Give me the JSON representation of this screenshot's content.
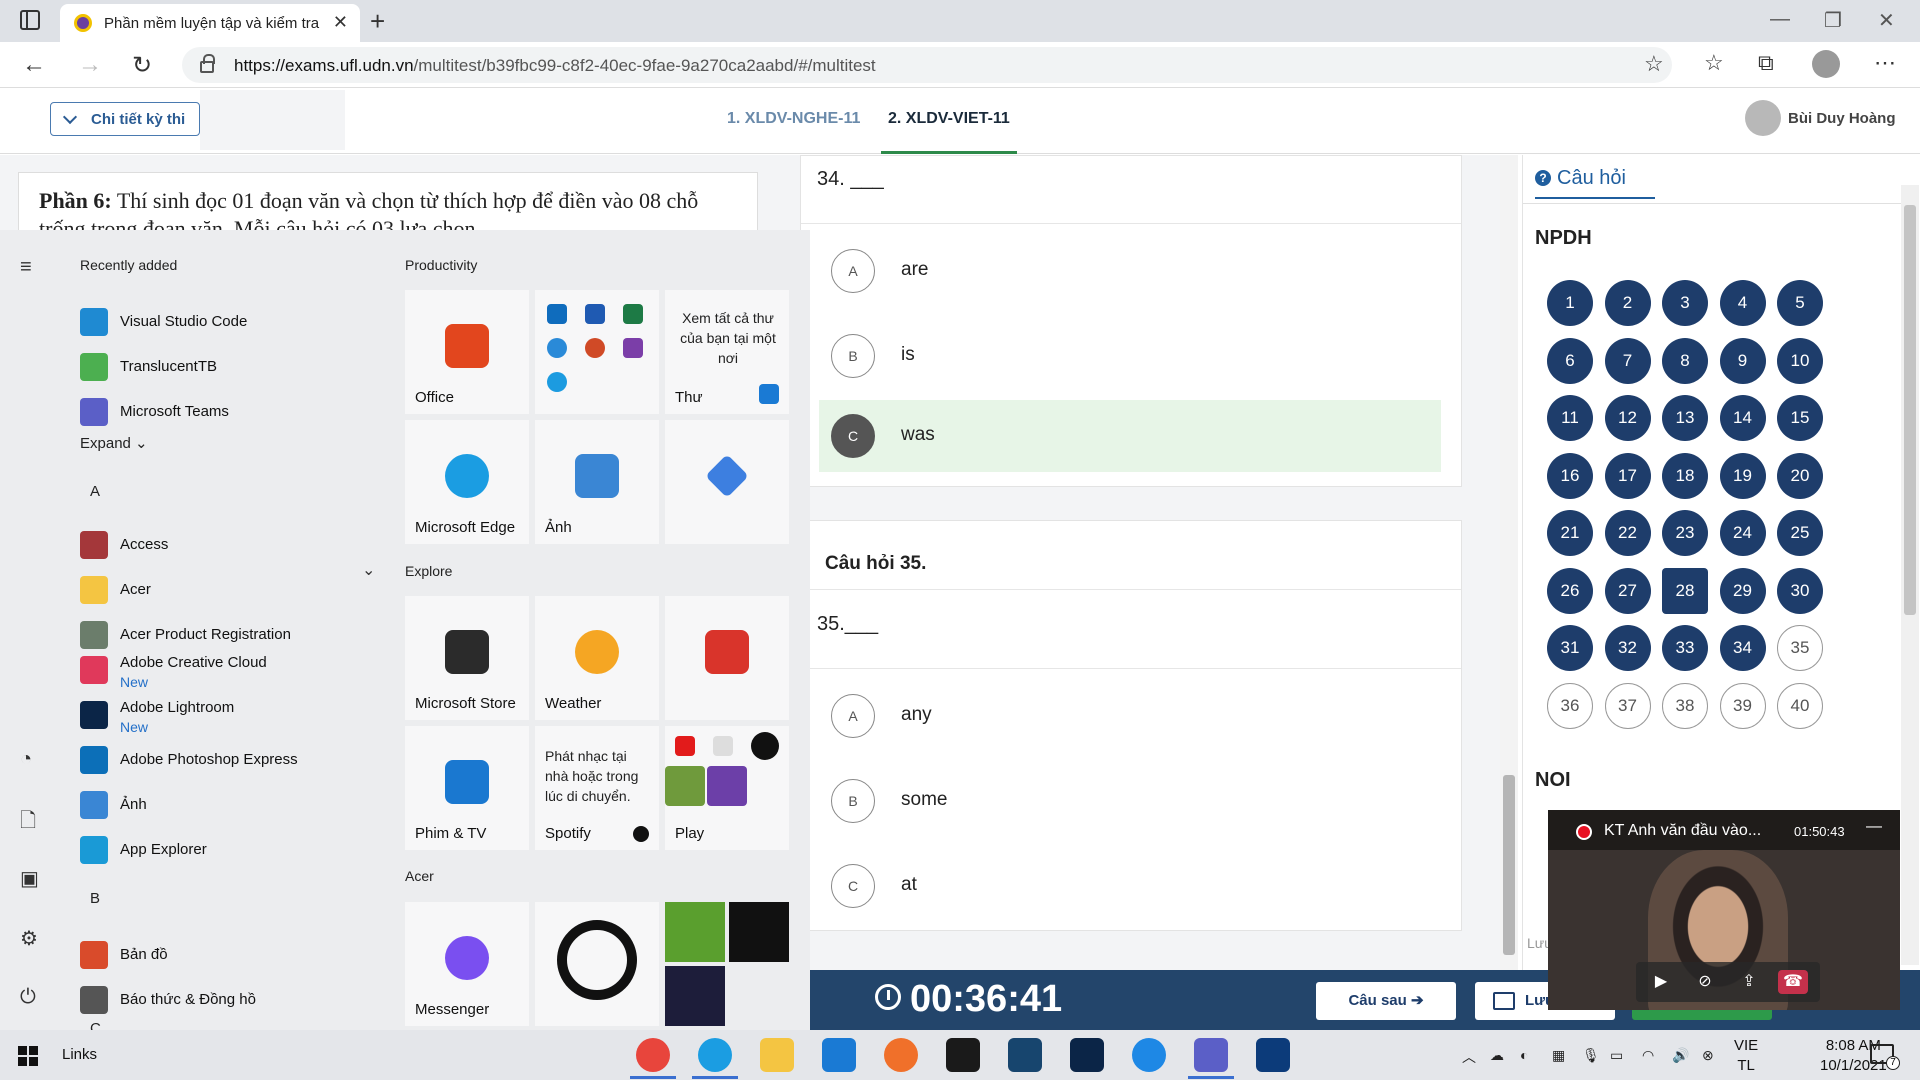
{
  "browser": {
    "tab_title": "Phần mềm luyện tập và kiểm tra",
    "url_host": "https://exams.ufl.udn.vn",
    "url_path": "/multitest/b39fbc99-c8f2-40ec-9fae-9a270ca2aabd/#/multitest"
  },
  "header": {
    "detail_button": "Chi tiết kỳ thi",
    "tabs": [
      "1. XLDV-NGHE-11",
      "2. XLDV-VIET-11"
    ],
    "user_name": "Bùi Duy Hoàng"
  },
  "passage": {
    "label": "Phần 6:",
    "text": "Thí sinh đọc 01 đoạn văn và chọn từ thích hợp để điền vào 08 chỗ trống trong đoạn văn. Mỗi câu hỏi có 03 lựa chọn"
  },
  "questions": [
    {
      "prompt": "34. ___",
      "options": [
        {
          "letter": "A",
          "text": "are"
        },
        {
          "letter": "B",
          "text": "is"
        },
        {
          "letter": "C",
          "text": "was",
          "selected": true
        }
      ]
    },
    {
      "title": "Câu hỏi 35.",
      "prompt": "35.___",
      "options": [
        {
          "letter": "A",
          "text": "any"
        },
        {
          "letter": "B",
          "text": "some"
        },
        {
          "letter": "C",
          "text": "at"
        }
      ]
    }
  ],
  "navigator": {
    "heading": "Câu hỏi",
    "section1": "NPDH",
    "section2": "NOI",
    "answered_up_to": 34,
    "current": 28,
    "numbers": [
      "1",
      "2",
      "3",
      "4",
      "5",
      "6",
      "7",
      "8",
      "9",
      "10",
      "11",
      "12",
      "13",
      "14",
      "15",
      "16",
      "17",
      "18",
      "19",
      "20",
      "21",
      "22",
      "23",
      "24",
      "25",
      "26",
      "27",
      "28",
      "29",
      "30",
      "31",
      "32",
      "33",
      "34",
      "35",
      "36",
      "37",
      "38",
      "39",
      "40"
    ],
    "cut_text": "Lưu"
  },
  "bottom": {
    "timer": "00:36:41",
    "next": "Câu sau",
    "save": "Lưu"
  },
  "start_menu": {
    "recently_added": "Recently added",
    "expand": "Expand",
    "productivity": "Productivity",
    "explore": "Explore",
    "acer_group": "Acer",
    "letters": [
      "A",
      "B",
      "C"
    ],
    "apps": [
      {
        "label": "Visual Studio Code",
        "color": "#1f8ad2"
      },
      {
        "label": "TranslucentTB",
        "color": "#4caf50"
      },
      {
        "label": "Microsoft Teams",
        "color": "#5b5fc7"
      },
      {
        "label": "Access",
        "color": "#a4373a"
      },
      {
        "label": "Acer",
        "color": "#f4c542"
      },
      {
        "label": "Acer Product Registration",
        "color": "#6b7d6b"
      },
      {
        "label": "Adobe Creative Cloud",
        "new": "New",
        "color": "#e0395b"
      },
      {
        "label": "Adobe Lightroom",
        "new": "New",
        "color": "#0b2547"
      },
      {
        "label": "Adobe Photoshop Express",
        "color": "#0c6fb8"
      },
      {
        "label": "Ảnh",
        "color": "#3a86d4"
      },
      {
        "label": "App Explorer",
        "color": "#1a9ad6"
      },
      {
        "label": "Bản đồ",
        "color": "#d94b2b"
      },
      {
        "label": "Báo thức & Đồng hồ",
        "color": "#555"
      }
    ],
    "tiles": {
      "office": "Office",
      "mail_desc": "Xem tất cả thư của bạn tại một nơi",
      "mail": "Thư",
      "edge": "Microsoft Edge",
      "photos": "Ảnh",
      "store": "Microsoft Store",
      "weather": "Weather",
      "movies": "Phim & TV",
      "spotify_desc": "Phát nhạc tại nhà hoặc trong lúc di chuyển.",
      "spotify": "Spotify",
      "play": "Play",
      "messenger": "Messenger"
    }
  },
  "video": {
    "title": "KT Anh văn đầu vào...",
    "time": "01:50:43"
  },
  "taskbar": {
    "links": "Links",
    "lang_top": "VIE",
    "lang_bottom": "TL",
    "time": "8:08 AM",
    "date": "10/1/2021",
    "notif_count": "7",
    "apps": [
      "chrome",
      "edge",
      "explorer",
      "mail",
      "firefox",
      "dropbox",
      "remote",
      "lightroom",
      "zalo",
      "teams",
      "photoshop"
    ]
  }
}
